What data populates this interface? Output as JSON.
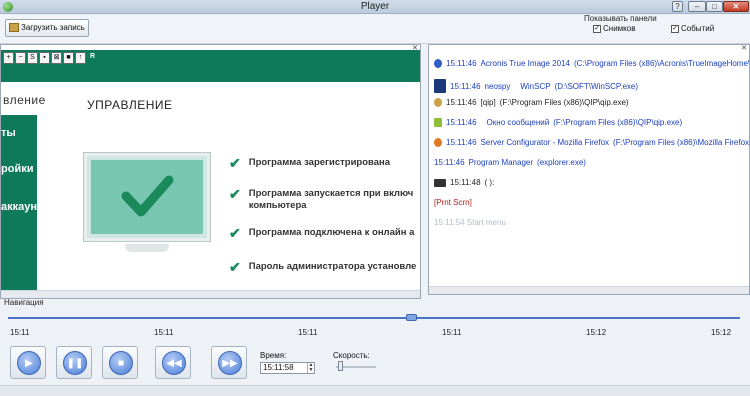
{
  "window": {
    "title": "Player"
  },
  "toolbar": {
    "load_label": "Загрузить запись",
    "panels_title": "Показывать панели",
    "cb_snapshots_label": "Снимков",
    "cb_events_label": "Событий"
  },
  "snapshot": {
    "menu_item_1": "вление",
    "sidebar_item_1": "ты",
    "sidebar_item_2": "ройки",
    "sidebar_item_3": "аккаунт",
    "heading": "УПРАВЛЕНИЕ",
    "checks": [
      "Программа зарегистрирована",
      "Программа запускается при включ",
      "компьютера",
      "Программа подключена к онлайн а",
      "Пароль администратора установле"
    ],
    "tool_s": "S",
    "tool_r": "R"
  },
  "events": [
    {
      "time": "15:11:46",
      "app": "Acronis True Image 2014",
      "path": "(C:\\Program Files (x86)\\Acronis\\TrueImageHome\\TrueIm"
    },
    {
      "time": "15:11:46",
      "app": "neospy",
      "extra": "WinSCP",
      "path": "(D:\\SOFT\\WinSCP.exe)"
    },
    {
      "time": "15:11:46",
      "app": "[qip]",
      "path": "(F:\\Program Files (x86)\\QIP\\qip.exe)"
    },
    {
      "time": "15:11:46",
      "app": "Окно сообщений",
      "path": "(F:\\Program Files (x86)\\QIP\\qip.exe)"
    },
    {
      "time": "15:11:46",
      "app": "Server Configurator - Mozilla Firefox",
      "path": "(F:\\Program Files (x86)\\Mozilla Firefox\\firefox.ex"
    },
    {
      "time": "15:11:46",
      "app": "Program Manager",
      "path": "(explorer.exe)"
    },
    {
      "time": "15:11:48",
      "app": "( ):"
    },
    {
      "text": "[Prnt Scrn]"
    },
    {
      "text": "15:11:54 Start menu"
    }
  ],
  "navigation": {
    "label": "Навигация",
    "progress": 0.55,
    "ticks": [
      "15:11",
      "15:11",
      "15:11",
      "15:11",
      "15:12",
      "15:12"
    ],
    "time_label": "Время:",
    "time_value": "15:11:58",
    "speed_label": "Скорость:",
    "speed_value": 0.05
  }
}
